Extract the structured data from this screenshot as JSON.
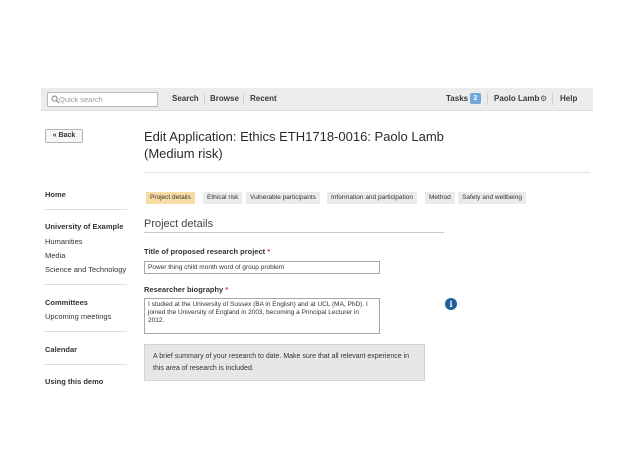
{
  "topbar": {
    "search_placeholder": "Quick search",
    "nav": [
      "Search",
      "Browse",
      "Recent"
    ],
    "tasks_label": "Tasks",
    "tasks_count": "2",
    "user_name": "Paolo Lamb",
    "help_label": "Help"
  },
  "back_label": "Back",
  "sidebar": {
    "home": "Home",
    "university": "University of Example",
    "university_items": [
      "Humanities",
      "Media",
      "Science and Technology"
    ],
    "committees": "Committees",
    "committee_items": [
      "Upcoming meetings"
    ],
    "calendar": "Calendar",
    "demo": "Using this demo"
  },
  "page": {
    "title": "Edit Application: Ethics ETH1718-0016: Paolo Lamb (Medium risk)",
    "tabs": [
      "Project details",
      "Ethical risk",
      "Vulnerable participants",
      "Information and participation",
      "Method",
      "Safety and wellbeing"
    ],
    "active_tab": "Project details",
    "section_title": "Project details"
  },
  "form": {
    "title_label": "Title of proposed research project",
    "title_value": "Power thing child month word of group problem",
    "bio_label": "Researcher biography",
    "bio_value": "I studied at the University of Sussex (BA in English) and at UCL (MA, PhD). I joined the University of England in 2003, becoming a Principal Lecturer in 2012.",
    "required_mark": "*",
    "help_text": "A brief summary of your research to date. Make sure that all relevant experience in this area of research is included."
  },
  "colors": {
    "active_tab": "#f7dca6",
    "badge": "#6fa7d9",
    "info_icon": "#1f5f9f",
    "required": "#d23b3b"
  }
}
